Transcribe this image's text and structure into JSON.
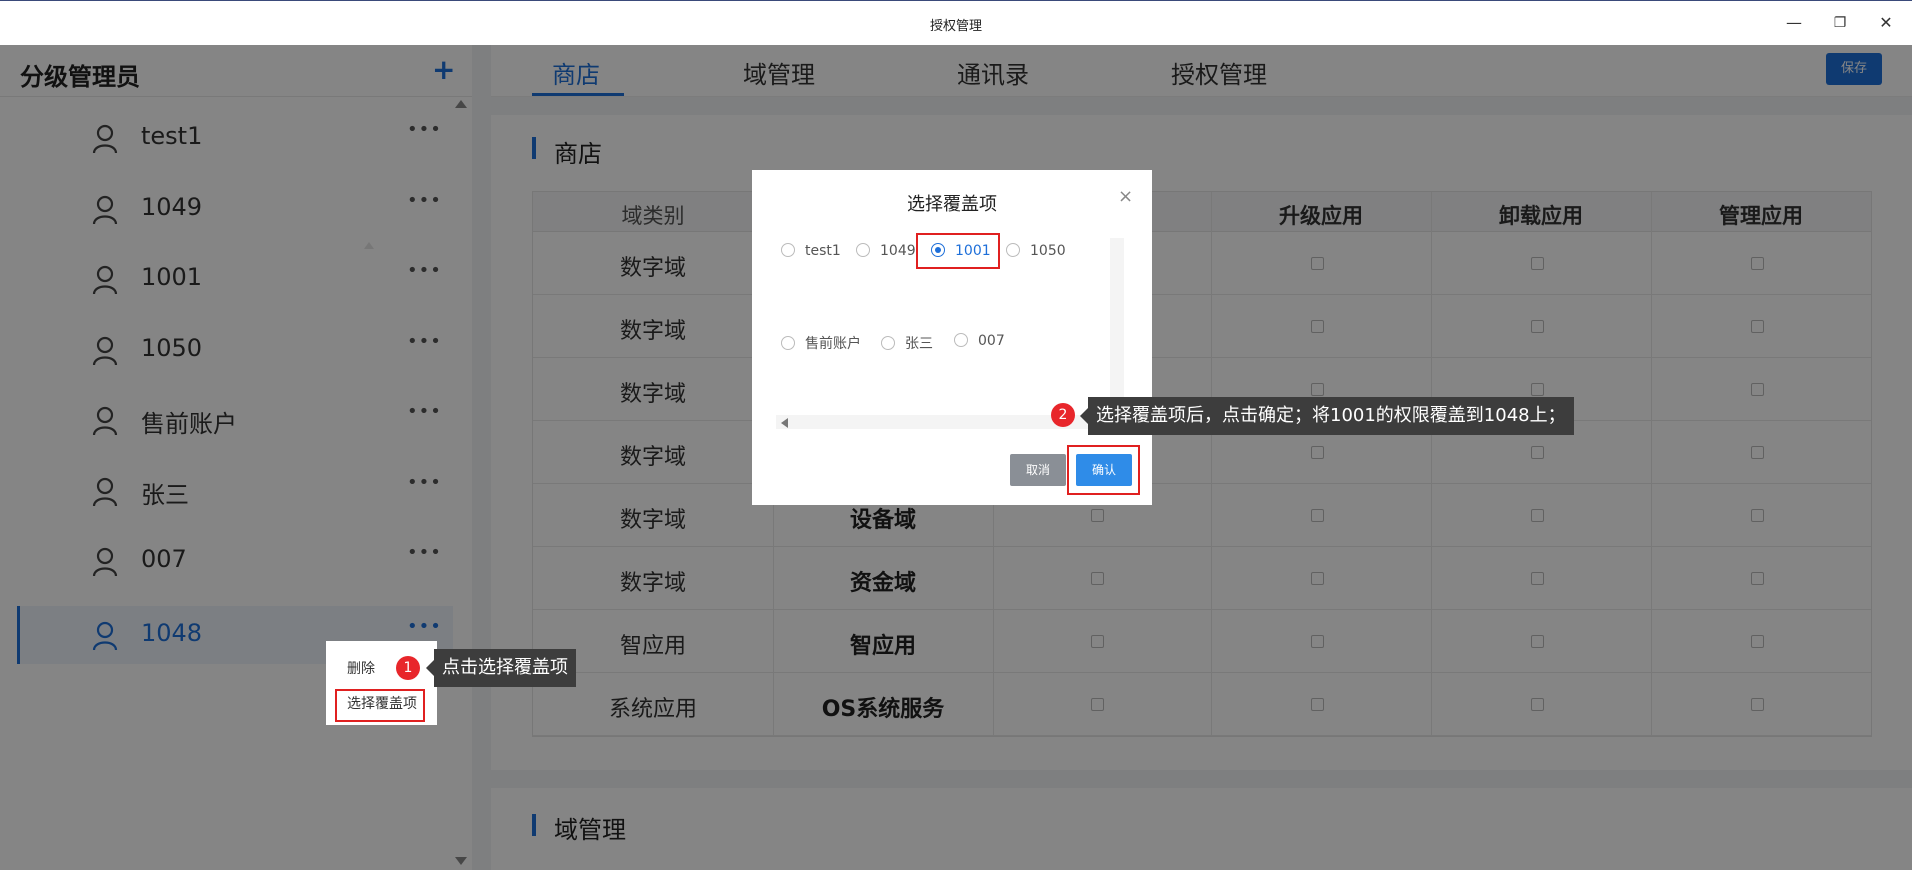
{
  "window": {
    "title": "授权管理",
    "minimize": "—",
    "restore": "❐",
    "close": "✕"
  },
  "sidebar": {
    "title": "分级管理员",
    "add_label": "+",
    "items": [
      {
        "label": "test1"
      },
      {
        "label": "1049"
      },
      {
        "label": "1001"
      },
      {
        "label": "1050"
      },
      {
        "label": "售前账户"
      },
      {
        "label": "张三"
      },
      {
        "label": "007"
      },
      {
        "label": "1048",
        "active": true
      }
    ],
    "more_label": "•••"
  },
  "tabs": {
    "items": [
      {
        "label": "商店",
        "active": true
      },
      {
        "label": "域管理"
      },
      {
        "label": "通讯录"
      },
      {
        "label": "授权管理"
      }
    ],
    "save_label": "保存"
  },
  "store_section": {
    "title": "商店",
    "columns": [
      "域类别",
      "",
      "",
      "升级应用",
      "卸载应用",
      "管理应用"
    ],
    "rows": [
      {
        "category": "数字域",
        "name": ""
      },
      {
        "category": "数字域",
        "name": ""
      },
      {
        "category": "数字域",
        "name": ""
      },
      {
        "category": "数字域",
        "name": ""
      },
      {
        "category": "数字域",
        "name": "设备域"
      },
      {
        "category": "数字域",
        "name": "资金域"
      },
      {
        "category": "智应用",
        "name": "智应用"
      },
      {
        "category": "系统应用",
        "name": "OS系统服务"
      }
    ]
  },
  "domain_section": {
    "title": "域管理"
  },
  "context_menu": {
    "items": [
      {
        "label": "删除"
      },
      {
        "label": "选择覆盖项"
      }
    ]
  },
  "tooltip1": {
    "badge": "1",
    "text": "点击选择覆盖项"
  },
  "tooltip2": {
    "badge": "2",
    "text": "选择覆盖项后，点击确定；将1001的权限覆盖到1048上；"
  },
  "dialog": {
    "title": "选择覆盖项",
    "close": "×",
    "options": [
      {
        "label": "test1"
      },
      {
        "label": "1049"
      },
      {
        "label": "1001",
        "selected": true
      },
      {
        "label": "1050"
      },
      {
        "label": "售前账户"
      },
      {
        "label": "张三"
      },
      {
        "label": "007"
      }
    ],
    "cancel_label": "取消",
    "ok_label": "确认"
  },
  "colors": {
    "accent": "#1e6fd9",
    "highlight": "#e02020",
    "badge": "#e8262b",
    "tooltip_bg": "#3d3d3d"
  }
}
